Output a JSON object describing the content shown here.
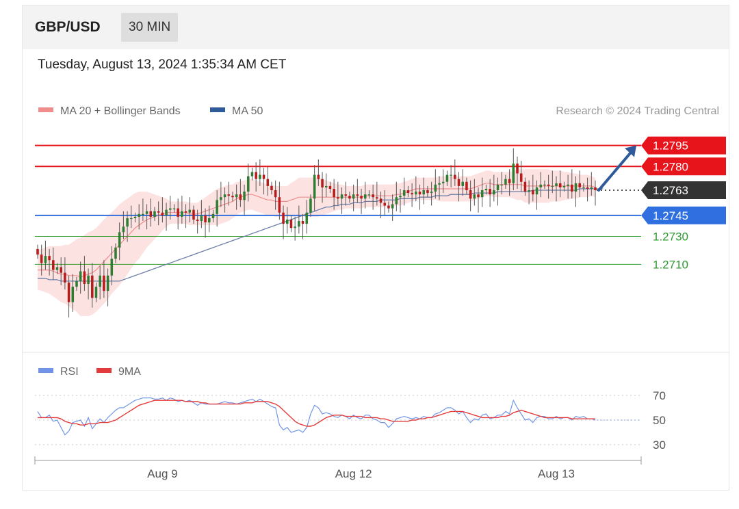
{
  "header": {
    "symbol": "GBP/USD",
    "timeframe": "30 MIN"
  },
  "datetime": "Tuesday, August 13, 2024 1:35:34 AM CET",
  "legend": {
    "ma20": "MA 20 + Bollinger Bands",
    "ma50": "MA 50",
    "credit": "Research © 2024 Trading Central",
    "rsi": "RSI",
    "rsi_ma": "9MA"
  },
  "colors": {
    "resistance": "#e8141b",
    "support": "#2f6fe0",
    "support_minor": "#2e9a2e",
    "current": "#333333",
    "candle_up": "#2e7d32",
    "candle_down": "#b71c1c",
    "bollinger_fill": "#fde2e2",
    "ma20": "#f08c8c",
    "ma50": "#6b7fa6",
    "rsi": "#6f94e8",
    "rsi_ma": "#e33b3b",
    "arrow": "#2f5b9a"
  },
  "chart_data": [
    {
      "type": "candlestick",
      "ylim": [
        1.2652,
        1.2808
      ],
      "levels": [
        {
          "value": 1.2795,
          "label": "1.2795",
          "kind": "resistance"
        },
        {
          "value": 1.278,
          "label": "1.2780",
          "kind": "resistance"
        },
        {
          "value": 1.2763,
          "label": "1.2763",
          "kind": "current"
        },
        {
          "value": 1.2745,
          "label": "1.2745",
          "kind": "support"
        },
        {
          "value": 1.273,
          "label": "1.2730",
          "kind": "support_minor"
        },
        {
          "value": 1.271,
          "label": "1.2710",
          "kind": "support_minor"
        }
      ],
      "x_ticks": [
        {
          "index": 32,
          "label": "Aug 9"
        },
        {
          "index": 81,
          "label": "Aug 12"
        },
        {
          "index": 133,
          "label": "Aug 13"
        }
      ],
      "close": [
        1.2717,
        1.2711,
        1.2716,
        1.2713,
        1.2706,
        1.2708,
        1.2704,
        1.2697,
        1.2683,
        1.2694,
        1.2698,
        1.2705,
        1.2696,
        1.2702,
        1.2686,
        1.2694,
        1.2702,
        1.2691,
        1.2702,
        1.2714,
        1.2722,
        1.2733,
        1.2737,
        1.2743,
        1.2743,
        1.2744,
        1.2746,
        1.2746,
        1.2748,
        1.2744,
        1.2748,
        1.2747,
        1.2745,
        1.2749,
        1.275,
        1.275,
        1.2744,
        1.2748,
        1.2747,
        1.2749,
        1.2742,
        1.2741,
        1.2745,
        1.274,
        1.2743,
        1.2746,
        1.2756,
        1.2758,
        1.276,
        1.2759,
        1.2758,
        1.276,
        1.2756,
        1.2762,
        1.2773,
        1.2776,
        1.2771,
        1.2774,
        1.2771,
        1.2766,
        1.2763,
        1.2758,
        1.2747,
        1.2739,
        1.2742,
        1.2736,
        1.2737,
        1.2741,
        1.2739,
        1.2747,
        1.2757,
        1.2774,
        1.2771,
        1.2765,
        1.2766,
        1.2764,
        1.2758,
        1.2757,
        1.276,
        1.2759,
        1.2757,
        1.276,
        1.2759,
        1.2757,
        1.276,
        1.276,
        1.2758,
        1.2757,
        1.2754,
        1.2752,
        1.275,
        1.2753,
        1.2758,
        1.2759,
        1.2763,
        1.2761,
        1.276,
        1.2762,
        1.276,
        1.2763,
        1.2761,
        1.2762,
        1.2767,
        1.2768,
        1.2769,
        1.2774,
        1.2774,
        1.2771,
        1.2766,
        1.2769,
        1.2763,
        1.2757,
        1.276,
        1.2758,
        1.2763,
        1.2764,
        1.276,
        1.2763,
        1.2767,
        1.2767,
        1.2771,
        1.2768,
        1.2782,
        1.2775,
        1.2769,
        1.2762,
        1.2763,
        1.276,
        1.2765,
        1.2767,
        1.2767,
        1.2766,
        1.2766,
        1.2768,
        1.2765,
        1.2766,
        1.2767,
        1.2762,
        1.2768,
        1.2765,
        1.2765,
        1.2764,
        1.2765,
        1.2763
      ],
      "ma20": [
        1.2706,
        1.2706,
        1.2706,
        1.2706,
        1.2705,
        1.2704,
        1.2703,
        1.2703,
        1.2702,
        1.2702,
        1.2702,
        1.2701,
        1.2702,
        1.2703,
        1.2704,
        1.2706,
        1.2709,
        1.2712,
        1.2715,
        1.2718,
        1.2721,
        1.2724,
        1.2727,
        1.273,
        1.2733,
        1.2736,
        1.2738,
        1.274,
        1.2742,
        1.2743,
        1.2744,
        1.2745,
        1.2746,
        1.2747,
        1.2747,
        1.2747,
        1.2747,
        1.2747,
        1.2747,
        1.2746,
        1.2746,
        1.2746,
        1.2747,
        1.2748,
        1.2749,
        1.275,
        1.2751,
        1.2752,
        1.2753,
        1.2754,
        1.2755,
        1.2757,
        1.2758,
        1.2759,
        1.276,
        1.276,
        1.2759,
        1.2758,
        1.2757,
        1.2756,
        1.2756,
        1.2755,
        1.2755,
        1.2755,
        1.2755,
        1.2756,
        1.2757,
        1.2758,
        1.2758,
        1.2758,
        1.2758,
        1.2758,
        1.2758,
        1.2758,
        1.2758,
        1.2758,
        1.2758,
        1.2758,
        1.2758,
        1.2758,
        1.2758,
        1.2758,
        1.2758,
        1.2758,
        1.2759,
        1.2759,
        1.2759,
        1.2759,
        1.2759,
        1.2759,
        1.2759,
        1.2759,
        1.276,
        1.276,
        1.2761,
        1.2762,
        1.2763,
        1.2764,
        1.2764,
        1.2764,
        1.2764,
        1.2764,
        1.2764,
        1.2764,
        1.2764,
        1.2764,
        1.2764,
        1.2764,
        1.2764,
        1.2764,
        1.2764,
        1.2764,
        1.2765,
        1.2766,
        1.2767,
        1.2768,
        1.2768,
        1.2767,
        1.2767,
        1.2767,
        1.2767,
        1.2767,
        1.2767,
        1.2767,
        1.2767,
        1.2766,
        1.2766,
        1.2766,
        1.2766,
        1.2766,
        1.2766,
        1.2766,
        1.2766,
        1.2766,
        1.2766,
        1.2766,
        1.2766,
        1.2766,
        1.2766,
        1.2766,
        1.2766,
        1.2766,
        1.2766,
        1.2765
      ],
      "bb_width": [
        0.0014,
        0.0015,
        0.0016,
        0.0017,
        0.0018,
        0.0019,
        0.002,
        0.0021,
        0.0022,
        0.0024,
        0.0026,
        0.0028,
        0.0029,
        0.003,
        0.003,
        0.003,
        0.003,
        0.003,
        0.003,
        0.0029,
        0.0029,
        0.0029,
        0.0028,
        0.0027,
        0.0026,
        0.0025,
        0.0024,
        0.0022,
        0.002,
        0.0018,
        0.0016,
        0.0014,
        0.0012,
        0.001,
        0.0008,
        0.0008,
        0.0008,
        0.0008,
        0.0008,
        0.0008,
        0.0008,
        0.0008,
        0.0009,
        0.001,
        0.0011,
        0.0012,
        0.0013,
        0.0013,
        0.0013,
        0.0013,
        0.0012,
        0.0012,
        0.0011,
        0.0011,
        0.0011,
        0.0011,
        0.0011,
        0.0011,
        0.0011,
        0.0011,
        0.0011,
        0.0011,
        0.0011,
        0.0011,
        0.0011,
        0.0012,
        0.0013,
        0.0014,
        0.0014,
        0.0014,
        0.0014,
        0.0014,
        0.0014,
        0.0013,
        0.0012,
        0.0011,
        0.001,
        0.0009,
        0.0009,
        0.0008,
        0.0008,
        0.0008,
        0.0008,
        0.0008,
        0.0008,
        0.0008,
        0.0008,
        0.0008,
        0.0008,
        0.0008,
        0.0008,
        0.0008,
        0.0008,
        0.0008,
        0.0008,
        0.0008,
        0.0008,
        0.0008,
        0.0008,
        0.0008,
        0.0008,
        0.0008,
        0.0008,
        0.0009,
        0.0009,
        0.0009,
        0.0009,
        0.0009,
        0.0009,
        0.0009,
        0.0009,
        0.0009,
        0.0009,
        0.0009,
        0.0009,
        0.0009,
        0.0009,
        0.0009,
        0.0009,
        0.0009,
        0.0009,
        0.0009,
        0.001,
        0.0011,
        0.0011,
        0.0012,
        0.0012,
        0.0012,
        0.0012,
        0.0012,
        0.0012,
        0.0012,
        0.0011,
        0.0011,
        0.0011,
        0.001,
        0.001,
        0.0009,
        0.0009,
        0.0008,
        0.0008,
        0.0008,
        0.0007,
        0.0007
      ],
      "ma50": [
        1.27,
        1.27,
        1.27,
        1.2699,
        1.2699,
        1.2699,
        1.2698,
        1.2698,
        1.2698,
        1.2698,
        1.2698,
        1.2698,
        1.2698,
        1.2698,
        1.2698,
        1.2698,
        1.2698,
        1.2698,
        1.2698,
        1.2698,
        1.2698,
        1.2698,
        1.2699,
        1.27,
        1.2701,
        1.2702,
        1.2703,
        1.2704,
        1.2705,
        1.2706,
        1.2707,
        1.2708,
        1.2709,
        1.271,
        1.2711,
        1.2712,
        1.2713,
        1.2714,
        1.2715,
        1.2716,
        1.2717,
        1.2718,
        1.2719,
        1.272,
        1.2721,
        1.2722,
        1.2723,
        1.2724,
        1.2725,
        1.2726,
        1.2727,
        1.2728,
        1.2729,
        1.273,
        1.2731,
        1.2732,
        1.2733,
        1.2734,
        1.2735,
        1.2736,
        1.2737,
        1.2738,
        1.2739,
        1.274,
        1.2741,
        1.2742,
        1.2743,
        1.2744,
        1.2745,
        1.2746,
        1.2747,
        1.2748,
        1.2749,
        1.275,
        1.2751,
        1.2751,
        1.2752,
        1.2752,
        1.2753,
        1.2753,
        1.2753,
        1.2754,
        1.2754,
        1.2754,
        1.2755,
        1.2755,
        1.2755,
        1.2755,
        1.2756,
        1.2756,
        1.2756,
        1.2756,
        1.2756,
        1.2757,
        1.2757,
        1.2757,
        1.2757,
        1.2757,
        1.2758,
        1.2758,
        1.2758,
        1.2758,
        1.2759,
        1.2759,
        1.2759,
        1.2759,
        1.276,
        1.276,
        1.276,
        1.276,
        1.276,
        1.276,
        1.2761,
        1.2761,
        1.2761,
        1.2761,
        1.2761,
        1.2761,
        1.2762,
        1.2762,
        1.2762,
        1.2762,
        1.2762,
        1.2762,
        1.2762,
        1.2762,
        1.2762,
        1.2763,
        1.2763,
        1.2763,
        1.2763,
        1.2763,
        1.2763,
        1.2763,
        1.2763,
        1.2763,
        1.2763,
        1.2763,
        1.2763,
        1.2764,
        1.2764,
        1.2764,
        1.2764,
        1.2764,
        1.2764,
        1.2764
      ],
      "projection": {
        "from": 1.2763,
        "to": 1.2795
      }
    },
    {
      "type": "line",
      "title": "RSI",
      "ylim": [
        20,
        80
      ],
      "y_ticks": [
        70,
        50,
        30
      ],
      "series": [
        {
          "name": "RSI",
          "values": [
            57,
            52,
            52,
            54,
            49,
            50,
            44,
            38,
            41,
            48,
            49,
            50,
            45,
            52,
            43,
            47,
            51,
            48,
            52,
            55,
            58,
            60,
            60,
            62,
            64,
            66,
            67,
            68,
            68,
            68,
            67,
            67,
            68,
            66,
            68,
            67,
            65,
            66,
            65,
            66,
            64,
            62,
            64,
            63,
            63,
            63,
            63,
            64,
            65,
            64,
            64,
            63,
            64,
            65,
            66,
            67,
            65,
            67,
            65,
            63,
            61,
            60,
            46,
            42,
            44,
            40,
            41,
            42,
            40,
            44,
            55,
            62,
            60,
            55,
            56,
            55,
            53,
            52,
            54,
            53,
            51,
            54,
            52,
            51,
            54,
            54,
            51,
            50,
            48,
            48,
            44,
            47,
            51,
            52,
            53,
            52,
            51,
            52,
            51,
            53,
            52,
            52,
            55,
            56,
            58,
            60,
            60,
            58,
            55,
            57,
            52,
            48,
            51,
            50,
            54,
            55,
            51,
            52,
            54,
            54,
            57,
            55,
            66,
            60,
            55,
            50,
            51,
            48,
            52,
            53,
            53,
            51,
            51,
            53,
            51,
            52,
            52,
            50,
            53,
            52,
            53,
            51,
            51,
            50
          ]
        },
        {
          "name": "9MA",
          "values": [
            52,
            52,
            52,
            52,
            52,
            52,
            51,
            49,
            48,
            47,
            47,
            46,
            46,
            47,
            47,
            47,
            48,
            48,
            48,
            49,
            50,
            52,
            54,
            56,
            58,
            60,
            62,
            63,
            64,
            65,
            66,
            66,
            66,
            66,
            66,
            66,
            66,
            66,
            65,
            65,
            65,
            65,
            64,
            64,
            63,
            63,
            63,
            63,
            63,
            63,
            63,
            63,
            63,
            64,
            64,
            64,
            65,
            65,
            65,
            65,
            64,
            63,
            61,
            58,
            55,
            52,
            49,
            47,
            46,
            45,
            45,
            46,
            48,
            50,
            52,
            53,
            54,
            54,
            54,
            53,
            53,
            53,
            53,
            53,
            52,
            52,
            52,
            52,
            51,
            51,
            50,
            49,
            49,
            49,
            49,
            49,
            50,
            50,
            51,
            51,
            52,
            52,
            53,
            54,
            55,
            56,
            57,
            57,
            57,
            57,
            56,
            55,
            54,
            53,
            52,
            52,
            52,
            52,
            52,
            53,
            53,
            54,
            56,
            57,
            58,
            57,
            56,
            55,
            54,
            53,
            52,
            52,
            52,
            52,
            52,
            52,
            52,
            51,
            51,
            51,
            51,
            51,
            51,
            51
          ]
        }
      ]
    }
  ]
}
